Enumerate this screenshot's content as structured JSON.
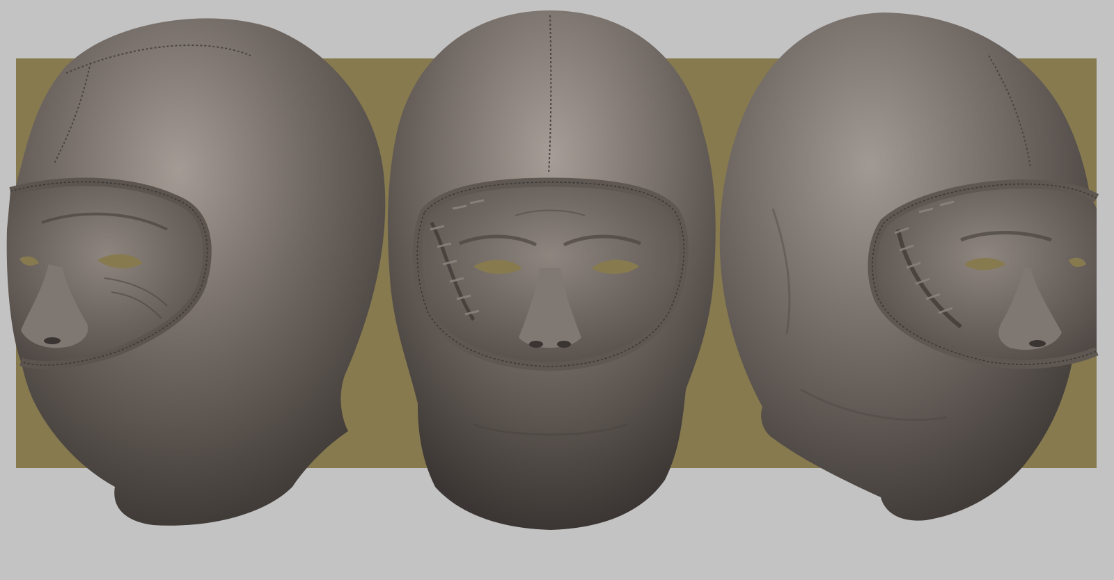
{
  "scene": {
    "subject": "leather-hood-head-sculpt",
    "views": [
      {
        "name": "left-three-quarter-view"
      },
      {
        "name": "front-view"
      },
      {
        "name": "right-three-quarter-view"
      }
    ],
    "colors": {
      "background": "#c3c3c3",
      "backdrop_panel": "#877a4f",
      "clay": "#6e6660",
      "clay_highlight": "#9a928b",
      "clay_shadow": "#3f3a37",
      "eye_holes": "#877a4f"
    }
  }
}
